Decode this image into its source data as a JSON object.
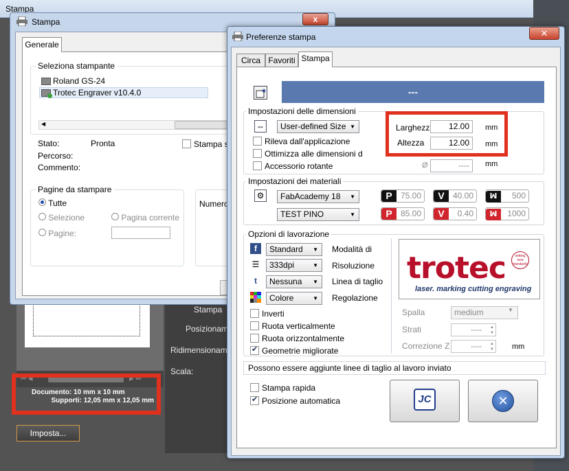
{
  "background_window": {
    "title": "Stampa",
    "labels": {
      "stampa_partial": "Stampa",
      "posizione": "Posizionam",
      "ridimensionamento": "Ridimensionam",
      "scala": "Scala:"
    },
    "document_info": {
      "documento": "Documento: 10 mm x 10 mm",
      "supporti": "Supporti: 12,05 mm x 12,05 mm"
    },
    "imposta_button": "Imposta..."
  },
  "stampa_dialog": {
    "title": "Stampa",
    "close_glyph": "x",
    "tab": "Generale",
    "select_printer_label": "Seleziona stampante",
    "printers": [
      "Roland GS-24",
      "Trotec Engraver v10.4.0"
    ],
    "stato_label": "Stato:",
    "stato_value": "Pronta",
    "percorso_label": "Percorso:",
    "commento_label": "Commento:",
    "stampa_su_label": "Stampa su",
    "pages_group_label": "Pagine da stampare",
    "pages_options": {
      "tutte": "Tutte",
      "selezione": "Selezione",
      "pagina_corrente": "Pagina corrente",
      "pagine": "Pagine:"
    },
    "numero_label": "Numero"
  },
  "pref_dialog": {
    "title": "Preferenze stampa",
    "close_glyph": "✕",
    "tabs": [
      "Circa",
      "Favoriti",
      "Stampa"
    ],
    "job_title": "---",
    "dimensions": {
      "section_label": "Impostazioni delle dimensioni",
      "size_combo": "User-defined Size",
      "rileva": "Rileva dall'applicazione",
      "ottimizza": "Ottimizza alle dimensioni del lav",
      "accessorio": "Accessorio rotante",
      "larghezza_label": "Larghezza",
      "larghezza_value": "12.00",
      "altezza_label": "Altezza",
      "altezza_value": "12.00",
      "unit": "mm",
      "diameter_symbol": "Ø",
      "diameter_value": "----",
      "diameter_unit": "mm"
    },
    "materials": {
      "section_label": "Impostazioni dei materiali",
      "material_combo_1": "FabAcademy 18",
      "material_combo_2": "TEST PINO",
      "row1": {
        "p": "75.00",
        "v": "40.00",
        "w": "500"
      },
      "row2": {
        "p": "85.00",
        "v": "0.40",
        "w": "1000"
      },
      "badge_p": "P",
      "badge_v": "V",
      "badge_w": "ꟽ"
    },
    "job_options": {
      "section_label": "Opzioni di lavorazione",
      "rows": [
        {
          "combo": "Standard",
          "label": "Modalità di"
        },
        {
          "combo": "333dpi",
          "label": "Risoluzione"
        },
        {
          "combo": "Nessuna",
          "label": "Linea di taglio"
        },
        {
          "combo": "Colore",
          "label": "Regolazione"
        }
      ],
      "checks": {
        "inverti": "Inverti",
        "ruota_v": "Ruota verticalmente",
        "ruota_o": "Ruota orizzontalmente",
        "geometrie": "Geometrie migliorate"
      },
      "spalla_label": "Spalla",
      "spalla_value": "medium",
      "strati_label": "Strati",
      "strati_value": "----",
      "correzione_label": "Correzione Z",
      "correzione_value": "----",
      "correzione_unit": "mm"
    },
    "logo": {
      "text": "trotec",
      "tagline": "laser. marking cutting engraving",
      "seal": "setting new standards"
    },
    "message": "Possono essere aggiunte linee di taglio al lavoro inviato",
    "stampa_rapida": "Stampa rapida",
    "posizione_automatica": "Posizione automatica",
    "jc_button_glyph": "JC",
    "cancel_glyph": "✕"
  },
  "colors": {
    "highlight_red": "#e0301e",
    "trotec_red": "#b8102a",
    "job_bar_blue": "#5a7aaf"
  }
}
